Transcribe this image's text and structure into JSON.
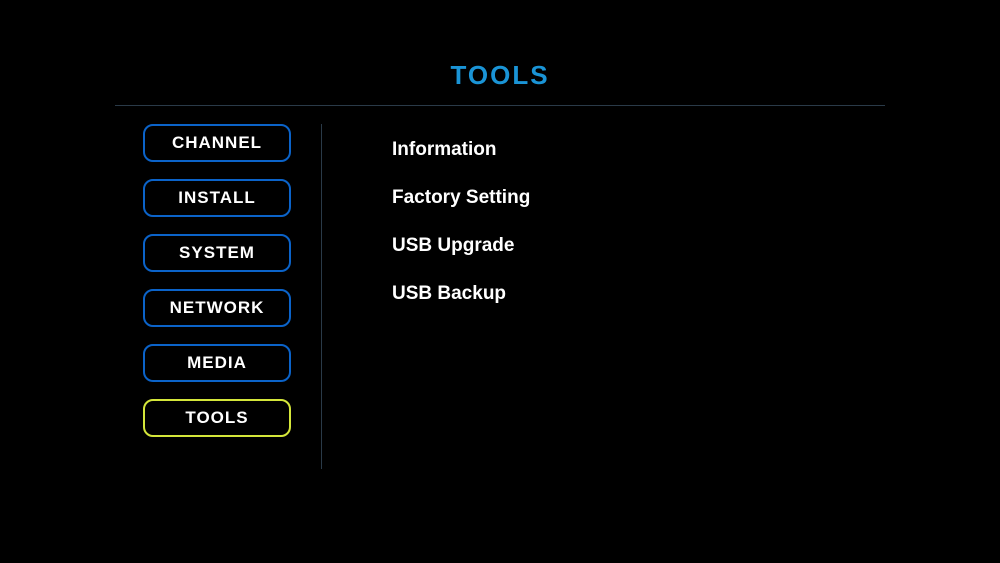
{
  "title": "TOOLS",
  "sidebar": {
    "items": [
      {
        "label": "CHANNEL",
        "active": false
      },
      {
        "label": "INSTALL",
        "active": false
      },
      {
        "label": "SYSTEM",
        "active": false
      },
      {
        "label": "NETWORK",
        "active": false
      },
      {
        "label": "MEDIA",
        "active": false
      },
      {
        "label": "TOOLS",
        "active": true
      }
    ]
  },
  "main": {
    "items": [
      {
        "label": "Information"
      },
      {
        "label": "Factory Setting"
      },
      {
        "label": "USB Upgrade"
      },
      {
        "label": "USB Backup"
      }
    ]
  }
}
